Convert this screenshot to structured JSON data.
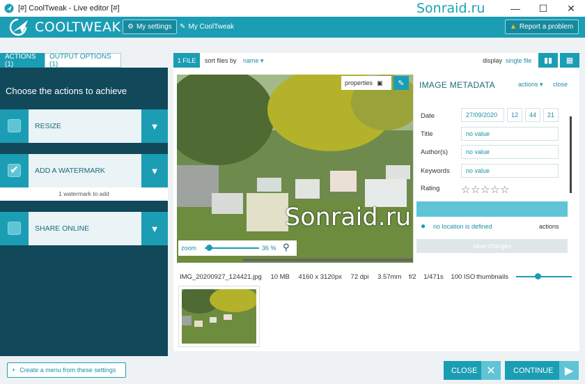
{
  "window": {
    "title": "[#] CoolTweak - Live editor [#]",
    "watermark": "Sonraid.ru",
    "minimize": "—",
    "maximize": "☐",
    "close": "✕"
  },
  "header": {
    "brand": "COOLTWEAK",
    "my_settings": "My settings",
    "my_cooltweak": "My CoolTweak",
    "report": "Report a problem"
  },
  "left": {
    "tabs": [
      {
        "label": "ACTIONS (1)"
      },
      {
        "label": "OUTPUT OPTIONS (1)"
      }
    ],
    "title": "Choose the actions to achieve",
    "actions": [
      {
        "label": "RESIZE",
        "checked": false
      },
      {
        "label": "ADD A WATERMARK",
        "checked": true,
        "sub": "1 watermark to add"
      },
      {
        "label": "SHARE ONLINE",
        "checked": false
      }
    ]
  },
  "toolbar": {
    "files": "1 FILE",
    "sort_label": "sort files by",
    "sort_value": "name",
    "display_label": "display",
    "display_value": "single file"
  },
  "viewer": {
    "properties": "properties",
    "zoom_label": "zoom",
    "zoom_value": "36 %",
    "watermark": "Sonraid.ru"
  },
  "metadata": {
    "title": "IMAGE METADATA",
    "actions": "actions",
    "close": "close",
    "date_label": "Date",
    "date": "27/09/2020",
    "hour": "12",
    "minute": "44",
    "second": "21",
    "title_label": "Title",
    "title_value": "no value",
    "authors_label": "Author(s)",
    "authors_value": "no value",
    "keywords_label": "Keywords",
    "keywords_value": "no value",
    "rating_label": "Rating",
    "location": "no location is defined",
    "location_actions": "actions",
    "save": "save changes"
  },
  "file_info": {
    "name": "IMG_20200927_124421.jpg",
    "size": "10 MB",
    "dimensions": "4160 x 3120px",
    "dpi": "72 dpi",
    "focal": "3.57mm",
    "aperture": "f/2",
    "exposure": "1/471s",
    "iso": "100 ISO",
    "thumbnails_label": "thumbnails"
  },
  "footer": {
    "create_menu": "Create a menu from these settings",
    "close": "CLOSE",
    "continue": "CONTINUE"
  }
}
